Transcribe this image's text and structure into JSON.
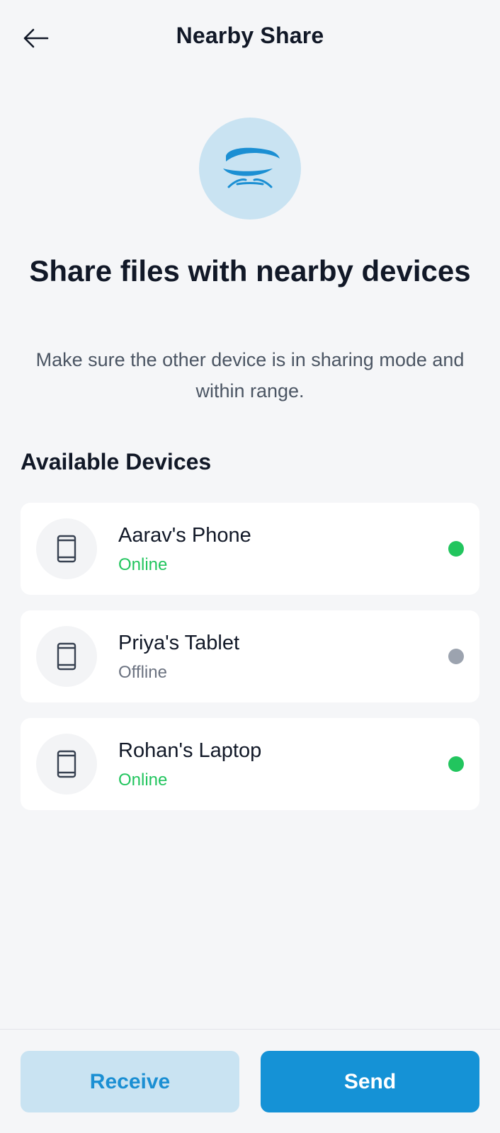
{
  "header": {
    "title": "Nearby Share",
    "back_icon": "arrow-left-icon"
  },
  "hero": {
    "icon": "nearby-share-icon",
    "icon_color": "#1b8fd3",
    "title": "Share files with nearby devices",
    "subtitle": "Make sure the other device is in sharing mode and within range."
  },
  "devices_section": {
    "title": "Available Devices",
    "devices": [
      {
        "name": "Aarav's Phone",
        "status": "Online",
        "status_color": "#22c55e",
        "icon": "smartphone-icon"
      },
      {
        "name": "Priya's Tablet",
        "status": "Offline",
        "status_color": "#9ca3af",
        "icon": "smartphone-icon"
      },
      {
        "name": "Rohan's Laptop",
        "status": "Online",
        "status_color": "#22c55e",
        "icon": "smartphone-icon"
      }
    ]
  },
  "actions": {
    "receive_label": "Receive",
    "send_label": "Send"
  },
  "colors": {
    "accent": "#1592d6",
    "accent_light": "#c9e3f2",
    "online": "#22c55e",
    "offline": "#9ca3af",
    "offline_text": "#6b7280"
  }
}
